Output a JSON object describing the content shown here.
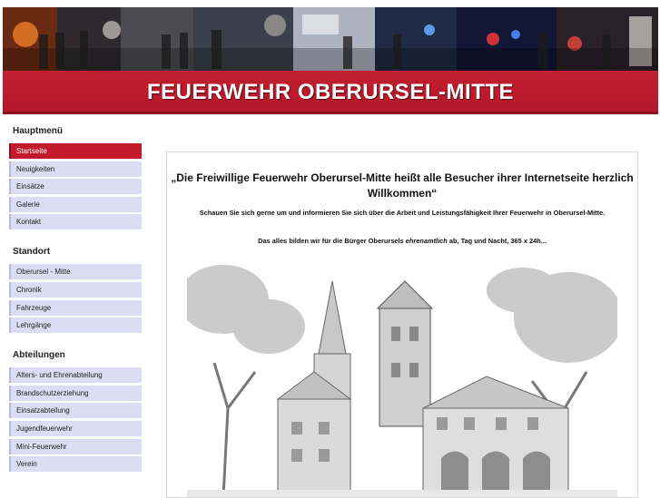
{
  "header": {
    "title": "FEUERWEHR OBERURSEL-MITTE"
  },
  "sidebar": {
    "sections": [
      {
        "heading": "Hauptmenü",
        "items": [
          "Startseite",
          "Neuigkeiten",
          "Einsätze",
          "Galerie",
          "Kontakt"
        ]
      },
      {
        "heading": "Standort",
        "items": [
          "Oberursel - Mitte",
          "Chronik",
          "Fahrzeuge",
          "Lehrgänge"
        ]
      },
      {
        "heading": "Abteilungen",
        "items": [
          "Alters- und Ehrenabteilung",
          "Brandschutzerziehung",
          "Einsatzabteilung",
          "Jugendfeuerwehr",
          "Mini-Feuerwehr",
          "Verein"
        ]
      }
    ],
    "active_item": "Startseite"
  },
  "main": {
    "welcome_line1": "„Die Freiwillige Feuerwehr Oberursel-Mitte heißt alle Besucher ihrer Internetseite herzlich",
    "welcome_line2": "Willkommen“",
    "intro": "Schauen Sie sich gerne um und informieren Sie sich über die Arbeit und Leistungsfähigkeit Ihrer Feuerwehr in Oberursel-Mitte.",
    "tagline_before": "Das alles bilden wir für die Bürger Oberursels ",
    "tagline_em": "ehrenamtlich",
    "tagline_after": " ab, Tag und Nacht, 365 x 24h..."
  },
  "colors": {
    "brand_red": "#c41b2c",
    "nav_bg": "#dcdcf2"
  }
}
